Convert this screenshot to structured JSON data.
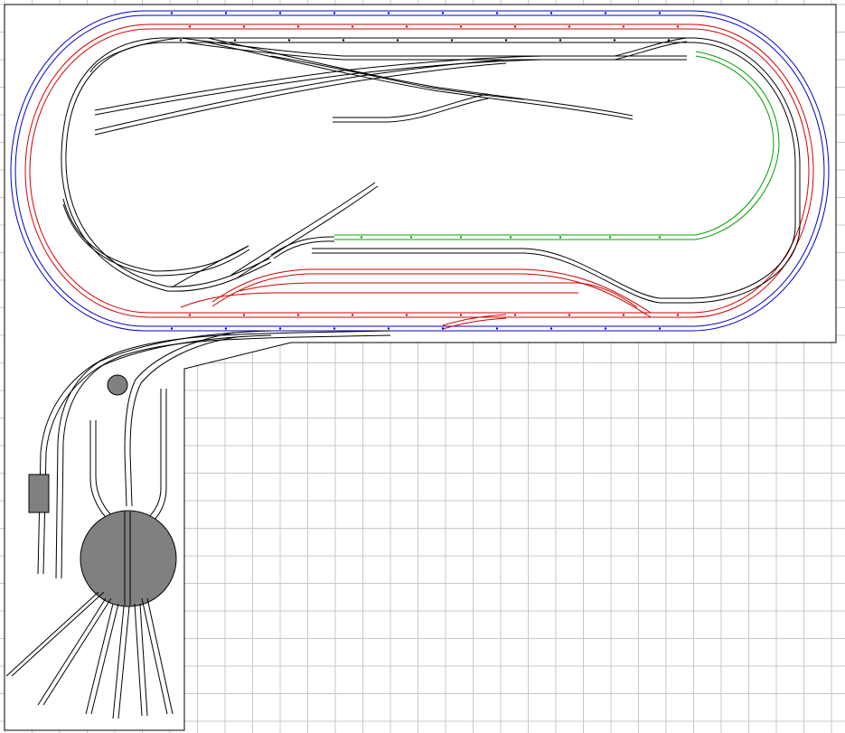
{
  "app": {
    "type": "model-railway-track-plan-editor",
    "visible_text": ""
  },
  "colors": {
    "background": "#ffffff",
    "grid": "#c8c8c8",
    "board_outline": "#000000",
    "track_default": "#000000",
    "track_outer_loop": "#0000cc",
    "track_middle_loop": "#d40000",
    "track_branch": "#00a000",
    "turntable_fill": "#808080",
    "structure_fill": "#808080"
  },
  "layout": {
    "loops": [
      {
        "id": "outer-loop",
        "color_key": "track_outer_loop"
      },
      {
        "id": "middle-loop",
        "color_key": "track_middle_loop"
      },
      {
        "id": "inner-loop",
        "color_key": "track_default"
      }
    ],
    "branch": {
      "id": "green-branch",
      "color_key": "track_branch"
    },
    "turntable": {
      "radial_tracks": 6
    },
    "yard": {
      "parallel_tracks": 3
    }
  }
}
